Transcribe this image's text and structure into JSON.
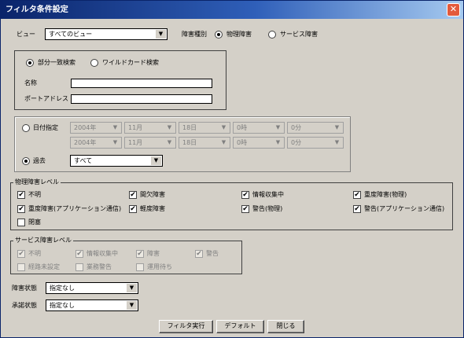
{
  "window": {
    "title": "フィルタ条件設定",
    "close_glyph": "✕"
  },
  "view": {
    "label": "ビュー",
    "value": "すべてのビュー"
  },
  "fault_type": {
    "label": "障害種別",
    "options": [
      "物理障害",
      "サービス障害"
    ],
    "selected": "物理障害"
  },
  "search": {
    "modes": [
      "部分一致検索",
      "ワイルドカード検索"
    ],
    "selected": "部分一致検索",
    "name_label": "名称",
    "name_value": "",
    "port_label": "ポートアドレス",
    "port_value": ""
  },
  "date": {
    "date_option_label": "日付指定",
    "row1": {
      "year": "2004年",
      "month": "11月",
      "day": "18日",
      "hour": "0時",
      "minute": "0分"
    },
    "row2": {
      "year": "2004年",
      "month": "11月",
      "day": "18日",
      "hour": "0時",
      "minute": "0分"
    },
    "past_option_label": "過去",
    "past_value": "すべて",
    "selected": "過去"
  },
  "physical_levels": {
    "legend": "物理障害レベル",
    "items": [
      {
        "label": "不明",
        "checked": true
      },
      {
        "label": "間欠障害",
        "checked": true
      },
      {
        "label": "情報収集中",
        "checked": true
      },
      {
        "label": "重度障害(物理)",
        "checked": true
      },
      {
        "label": "重度障害(アプリケーション通信)",
        "checked": true
      },
      {
        "label": "軽度障害",
        "checked": true
      },
      {
        "label": "警告(物理)",
        "checked": true
      },
      {
        "label": "警告(アプリケーション通信)",
        "checked": true
      },
      {
        "label": "閉塞",
        "checked": false
      }
    ]
  },
  "service_levels": {
    "legend": "サービス障害レベル",
    "items": [
      {
        "label": "不明",
        "checked": true
      },
      {
        "label": "情報収集中",
        "checked": true
      },
      {
        "label": "障害",
        "checked": true
      },
      {
        "label": "警告",
        "checked": true
      },
      {
        "label": "経路未設定",
        "checked": false
      },
      {
        "label": "業務警告",
        "checked": false
      },
      {
        "label": "運用待ち",
        "checked": false
      }
    ]
  },
  "fault_status": {
    "label": "障害状態",
    "value": "指定なし"
  },
  "approval_status": {
    "label": "承諾状態",
    "value": "指定なし"
  },
  "buttons": {
    "run": "フィルタ実行",
    "default": "デフォルト",
    "close": "閉じる"
  },
  "icons": {
    "dropdown": "▼",
    "check": "✔"
  }
}
